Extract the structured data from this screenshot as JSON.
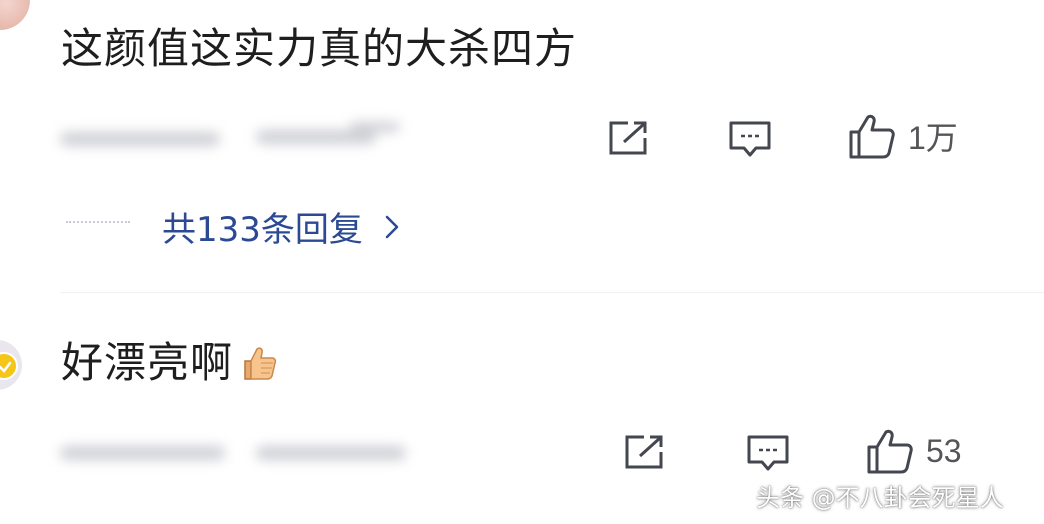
{
  "comments": [
    {
      "text": "这颜值这实力真的大杀四方",
      "likes": "1万",
      "replies_label": "共133条回复"
    },
    {
      "text": "好漂亮啊",
      "likes": "53"
    }
  ],
  "icons": {
    "share": "share-icon",
    "comment": "comment-icon",
    "like": "thumbs-up-icon",
    "chevron": "chevron-right-icon",
    "emoji": "thumbs-up-emoji-icon"
  },
  "colors": {
    "text": "#1e1e1e",
    "reply_link": "#2b4a93",
    "icon": "#44474f"
  },
  "watermark": "头条 @不八卦会死星人"
}
